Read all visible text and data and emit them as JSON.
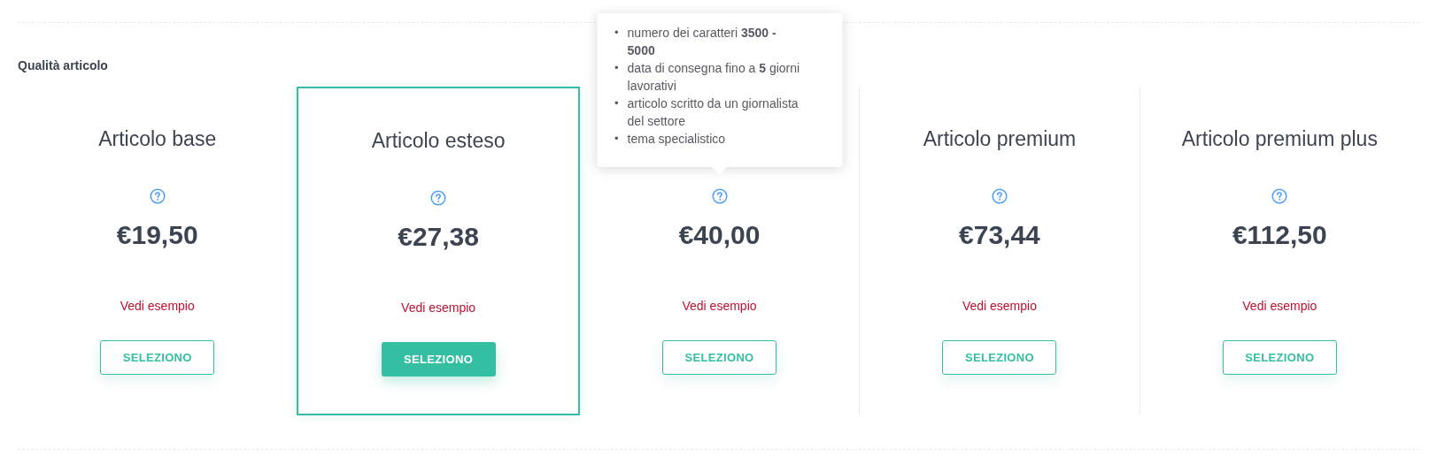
{
  "section": {
    "label": "Qualità articolo"
  },
  "plans": [
    {
      "title": "Articolo base",
      "price": "€19,50",
      "link": "Vedi esempio",
      "button": "SELEZIONO",
      "selected": false
    },
    {
      "title": "Articolo esteso",
      "price": "€27,38",
      "link": "Vedi esempio",
      "button": "SELEZIONO",
      "selected": true
    },
    {
      "price": "€40,00",
      "link": "Vedi esempio",
      "button": "SELEZIONO",
      "selected": false,
      "tooltip": [
        {
          "marker": "•",
          "text": "numero dei caratteri **3500 - 5000**"
        },
        {
          "marker": "•",
          "text": "data di consegna fino a **5** giorni lavorativi"
        },
        {
          "marker": "•",
          "text": "articolo scritto da un giornalista del settore"
        },
        {
          "marker": "•",
          "text": "tema specialistico"
        }
      ]
    },
    {
      "title": "Articolo premium",
      "price": "€73,44",
      "link": "Vedi esempio",
      "button": "SELEZIONO",
      "selected": false
    },
    {
      "title": "Articolo premium plus",
      "price": "€112,50",
      "link": "Vedi esempio",
      "button": "SELEZIONO",
      "selected": false
    }
  ]
}
